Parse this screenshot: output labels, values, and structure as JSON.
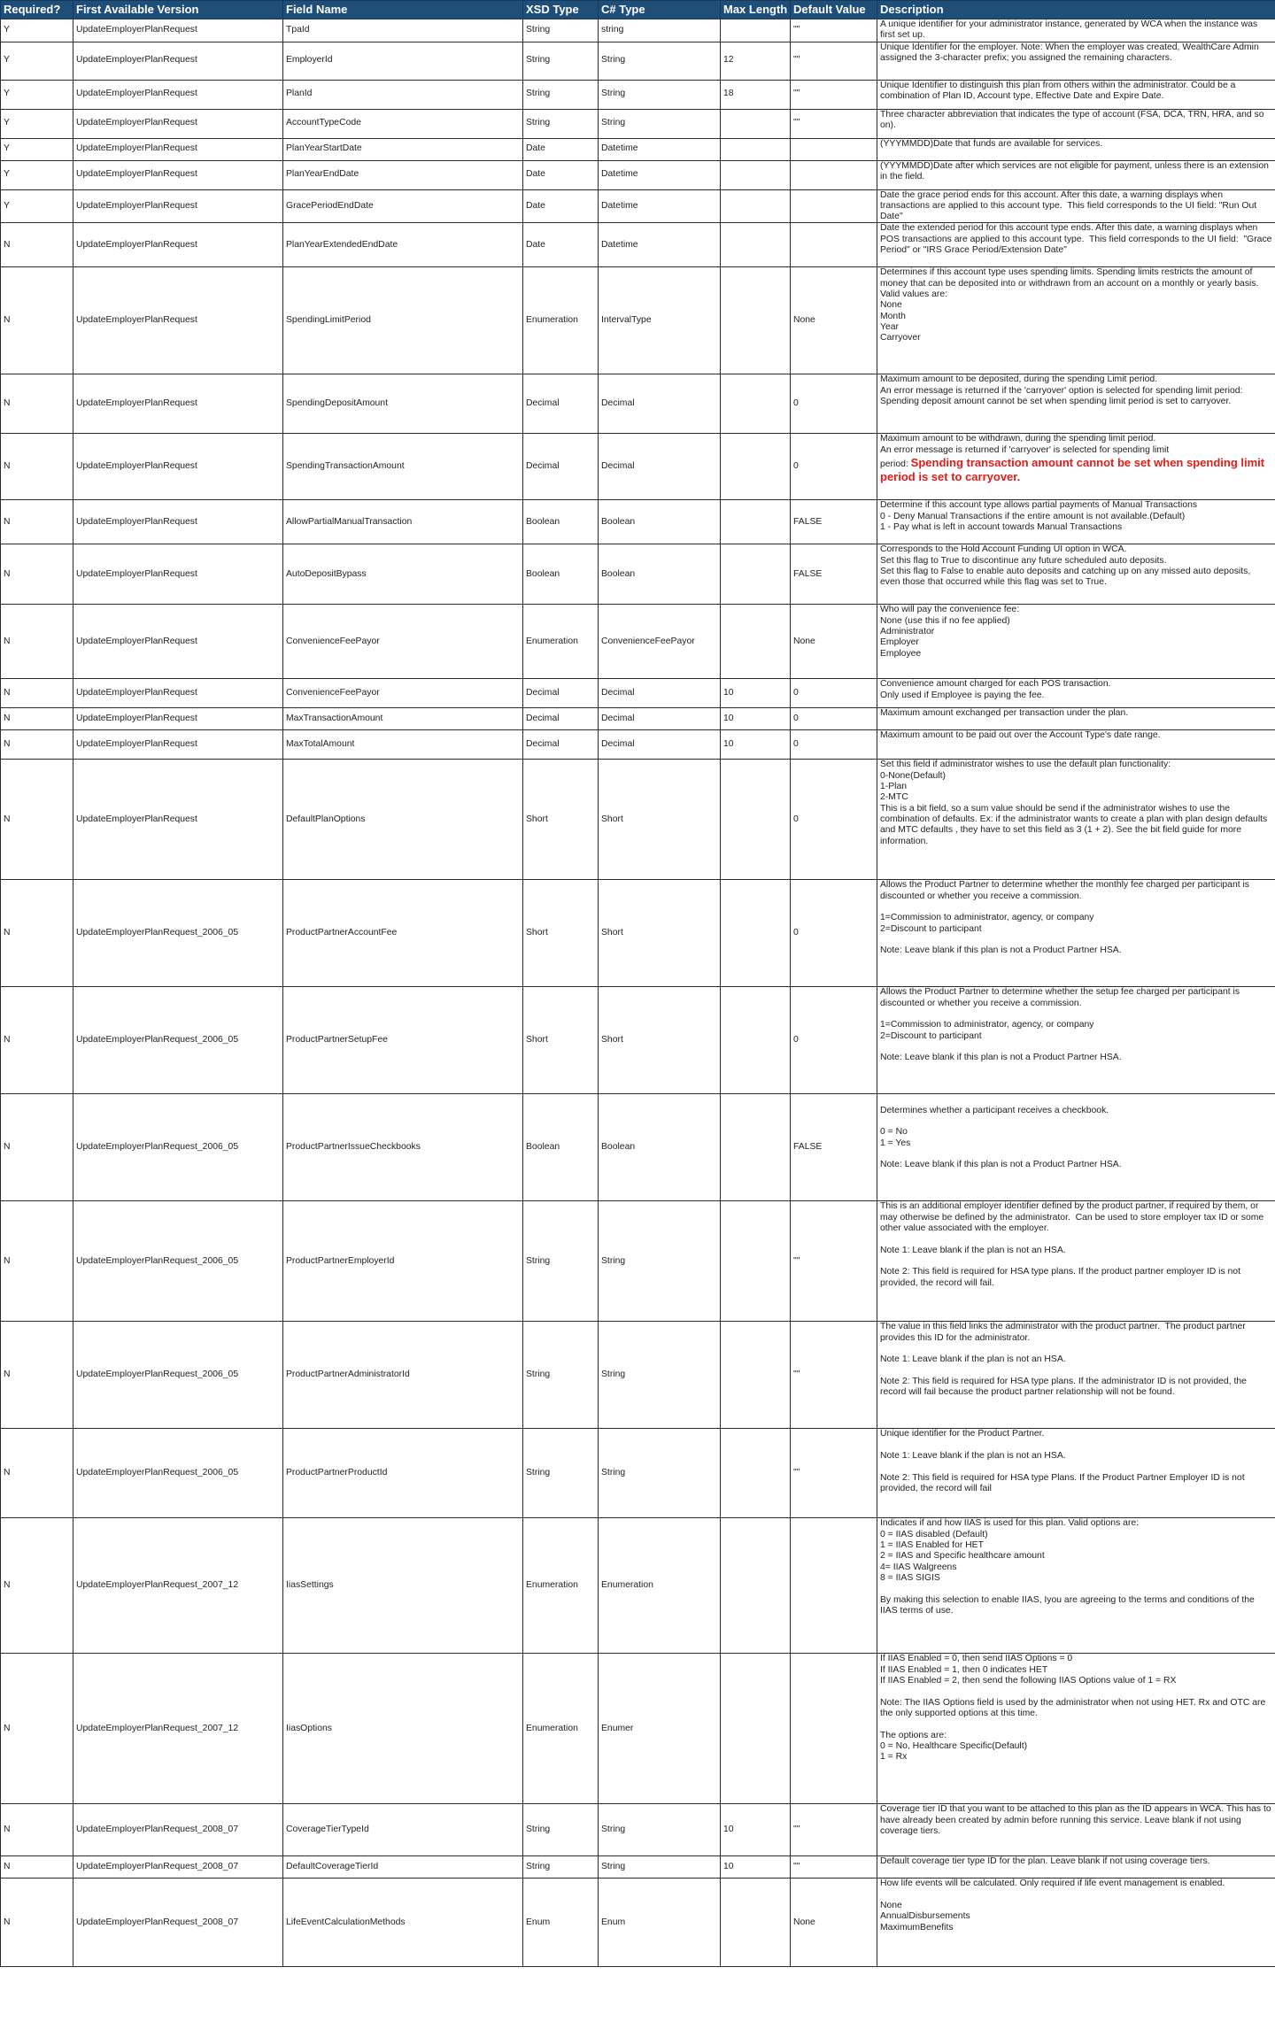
{
  "headers": [
    "Required?",
    "First Available Version",
    "Field Name",
    "XSD Type",
    "C# Type",
    "Max Length",
    "Default Value",
    "Description"
  ],
  "rows": [
    {
      "req": "Y",
      "ver": "UpdateEmployerPlanRequest",
      "field": "TpaId",
      "xsd": "String",
      "cs": "string",
      "max": "",
      "def": "\"\"",
      "desc": "A unique identifier for your administrator instance, generated by WCA when the instance was first set up."
    },
    {
      "req": "Y",
      "ver": "UpdateEmployerPlanRequest",
      "field": "EmployerId",
      "xsd": "String",
      "cs": "String",
      "max": "12",
      "def": "\"\"",
      "desc": "Unique Identifier for the employer. Note: When the employer was created, WealthCare Admin assigned the 3-character prefix; you assigned the remaining characters."
    },
    {
      "req": "Y",
      "ver": "UpdateEmployerPlanRequest",
      "field": "PlanId",
      "xsd": "String",
      "cs": "String",
      "max": "18",
      "def": "\"\"",
      "desc": "Unique Identifier to distinguish this plan from others within the administrator. Could be a combination of Plan ID, Account type, Effective Date and Expire Date."
    },
    {
      "req": "Y",
      "ver": "UpdateEmployerPlanRequest",
      "field": "AccountTypeCode",
      "xsd": "String",
      "cs": "String",
      "max": "",
      "def": "\"\"",
      "desc": "Three character abbreviation that indicates the type of account (FSA, DCA, TRN, HRA, and so on)."
    },
    {
      "req": "Y",
      "ver": "UpdateEmployerPlanRequest",
      "field": "PlanYearStartDate",
      "xsd": "Date",
      "cs": "Datetime",
      "max": "",
      "def": "",
      "desc": "(YYYMMDD)Date that funds are available for services."
    },
    {
      "req": "Y",
      "ver": "UpdateEmployerPlanRequest",
      "field": "PlanYearEndDate",
      "xsd": "Date",
      "cs": "Datetime",
      "max": "",
      "def": "",
      "desc": "(YYYMMDD)Date after which services are not eligible for payment, unless there is an extension in the field."
    },
    {
      "req": "Y",
      "ver": "UpdateEmployerPlanRequest",
      "field": "GracePeriodEndDate",
      "xsd": "Date",
      "cs": "Datetime",
      "max": "",
      "def": "",
      "desc": "Date the grace period ends for this account. After this date, a warning displays when transactions are applied to this account type.  This field corresponds to the UI field: \"Run Out Date\""
    },
    {
      "req": "N",
      "ver": "UpdateEmployerPlanRequest",
      "field": "PlanYearExtendedEndDate",
      "xsd": "Date",
      "cs": "Datetime",
      "max": "",
      "def": "",
      "desc": "Date the extended period for this account type ends. After this date, a warning displays when POS transactions are applied to this account type.  This field corresponds to the UI field:  \"Grace Period\" or \"IRS Grace Period/Extension Date\""
    },
    {
      "req": "N",
      "ver": "UpdateEmployerPlanRequest",
      "field": "SpendingLimitPeriod",
      "xsd": "Enumeration",
      "cs": "IntervalType",
      "max": "",
      "def": "None",
      "desc": "Determines if this account type uses spending limits. Spending limits restricts the amount of money that can be deposited into or withdrawn from an account on a monthly or yearly basis. Valid values are:\nNone\nMonth\nYear\nCarryover"
    },
    {
      "req": "N",
      "ver": "UpdateEmployerPlanRequest",
      "field": "SpendingDepositAmount",
      "xsd": "Decimal",
      "cs": "Decimal",
      "max": "",
      "def": "0",
      "desc": "Maximum amount to be deposited, during the spending Limit period.\nAn error message is returned if the 'carryover' option is selected for spending limit period: Spending deposit amount cannot be set when spending limit period is set to carryover."
    },
    {
      "req": "N",
      "ver": "UpdateEmployerPlanRequest",
      "field": "SpendingTransactionAmount",
      "xsd": "Decimal",
      "cs": "Decimal",
      "max": "",
      "def": "0",
      "desc": "Maximum amount to be withdrawn, during the spending limit period.\nAn error message is returned if 'carryover' is selected for spending limit\nperiod: ",
      "desc_warn": "Spending transaction amount cannot be set when spending limit period is set to carryover."
    },
    {
      "req": "N",
      "ver": "UpdateEmployerPlanRequest",
      "field": "AllowPartialManualTransaction",
      "xsd": "Boolean",
      "cs": "Boolean",
      "max": "",
      "def": "FALSE",
      "desc": "Determine if this account type allows partial payments of Manual Transactions\n0 - Deny Manual Transactions if the entire amount is not available.(Default)\n1 - Pay what is left in account towards Manual Transactions"
    },
    {
      "req": "N",
      "ver": "UpdateEmployerPlanRequest",
      "field": "AutoDepositBypass",
      "xsd": "Boolean",
      "cs": "Boolean",
      "max": "",
      "def": "FALSE",
      "desc": "Corresponds to the Hold Account Funding UI option in WCA.\nSet this flag to True to discontinue any future scheduled auto deposits.\nSet this flag to False to enable auto deposits and catching up on any missed auto deposits, even those that occurred while this flag was set to True."
    },
    {
      "req": "N",
      "ver": "UpdateEmployerPlanRequest",
      "field": "ConvenienceFeePayor",
      "xsd": "Enumeration",
      "cs": "ConvenienceFeePayor",
      "max": "",
      "def": "None",
      "desc": "Who will pay the convenience fee:\nNone (use this if no fee applied)\nAdministrator\nEmployer\nEmployee"
    },
    {
      "req": "N",
      "ver": "UpdateEmployerPlanRequest",
      "field": "ConvenienceFeePayor",
      "xsd": "Decimal",
      "cs": "Decimal",
      "max": "10",
      "def": "0",
      "desc": "Convenience amount charged for each POS transaction.\nOnly used if Employee is paying the fee."
    },
    {
      "req": "N",
      "ver": "UpdateEmployerPlanRequest",
      "field": "MaxTransactionAmount",
      "xsd": "Decimal",
      "cs": "Decimal",
      "max": "10",
      "def": "0",
      "desc": "Maximum amount exchanged per transaction under the plan."
    },
    {
      "req": "N",
      "ver": "UpdateEmployerPlanRequest",
      "field": "MaxTotalAmount",
      "xsd": "Decimal",
      "cs": "Decimal",
      "max": "10",
      "def": "0",
      "desc": "Maximum amount to be paid out over the Account Type's date range."
    },
    {
      "req": "N",
      "ver": "UpdateEmployerPlanRequest",
      "field": "DefaultPlanOptions",
      "xsd": "Short",
      "cs": "Short",
      "max": "",
      "def": "0",
      "desc": "Set this field if administrator wishes to use the default plan functionality:\n0-None(Default)\n1-Plan\n2-MTC\nThis is a bit field, so a sum value should be send if the administrator wishes to use the combination of defaults. Ex: if the administrator wants to create a plan with plan design defaults and MTC defaults , they have to set this field as 3 (1 + 2). See the bit field guide for more information."
    },
    {
      "req": "N",
      "ver": "UpdateEmployerPlanRequest_2006_05",
      "field": "ProductPartnerAccountFee",
      "xsd": "Short",
      "cs": "Short",
      "max": "",
      "def": "0",
      "desc": "Allows the Product Partner to determine whether the monthly fee charged per participant is discounted or whether you receive a commission.\n\n1=Commission to administrator, agency, or company\n2=Discount to participant\n\nNote: Leave blank if this plan is not a Product Partner HSA."
    },
    {
      "req": "N",
      "ver": "UpdateEmployerPlanRequest_2006_05",
      "field": "ProductPartnerSetupFee",
      "xsd": "Short",
      "cs": "Short",
      "max": "",
      "def": "0",
      "desc": "Allows the Product Partner to determine whether the setup fee charged per participant is discounted or whether you receive a commission.\n\n1=Commission to administrator, agency, or company\n2=Discount to participant\n\nNote: Leave blank if this plan is not a Product Partner HSA."
    },
    {
      "req": "N",
      "ver": "UpdateEmployerPlanRequest_2006_05",
      "field": "ProductPartnerIssueCheckbooks",
      "xsd": "Boolean",
      "cs": "Boolean",
      "max": "",
      "def": "FALSE",
      "desc": "\nDetermines whether a participant receives a checkbook.\n\n0 = No\n1 = Yes\n\nNote: Leave blank if this plan is not a Product Partner HSA."
    },
    {
      "req": "N",
      "ver": "UpdateEmployerPlanRequest_2006_05",
      "field": "ProductPartnerEmployerId",
      "xsd": "String",
      "cs": "String",
      "max": "",
      "def": "\"\"",
      "desc": "This is an additional employer identifier defined by the product partner, if required by them, or may otherwise be defined by the administrator.  Can be used to store employer tax ID or some other value associated with the employer.\n\nNote 1: Leave blank if the plan is not an HSA.\n\nNote 2: This field is required for HSA type plans. If the product partner employer ID is not provided, the record will fail."
    },
    {
      "req": "N",
      "ver": "UpdateEmployerPlanRequest_2006_05",
      "field": "ProductPartnerAdministratorId",
      "xsd": "String",
      "cs": "String",
      "max": "",
      "def": "\"\"",
      "desc": "The value in this field links the administrator with the product partner.  The product partner provides this ID for the administrator.\n\nNote 1: Leave blank if the plan is not an HSA.\n\nNote 2: This field is required for HSA type plans. If the administrator ID is not provided, the record will fail because the product partner relationship will not be found."
    },
    {
      "req": "N",
      "ver": "UpdateEmployerPlanRequest_2006_05",
      "field": "ProductPartnerProductId",
      "xsd": "String",
      "cs": "String",
      "max": "",
      "def": "\"\"",
      "desc": "Unique identifier for the Product Partner.\n\nNote 1: Leave blank if the plan is not an HSA.\n\nNote 2: This field is required for HSA type Plans. If the Product Partner Employer ID is not provided, the record will fail"
    },
    {
      "req": "N",
      "ver": "UpdateEmployerPlanRequest_2007_12",
      "field": "IiasSettings",
      "xsd": "Enumeration",
      "cs": "Enumeration",
      "max": "",
      "def": "",
      "desc": "Indicates if and how IIAS is used for this plan. Valid options are:\n0 = IIAS disabled (Default)\n1 = IIAS Enabled for HET\n2 = IIAS and Specific healthcare amount\n4= IIAS Walgreens\n8 = IIAS SIGIS\n\nBy making this selection to enable IIAS, Iyou are agreeing to the terms and conditions of the IIAS terms of use."
    },
    {
      "req": "N",
      "ver": "UpdateEmployerPlanRequest_2007_12",
      "field": "IiasOptions",
      "xsd": "Enumeration",
      "cs": "Enumer",
      "max": "",
      "def": "",
      "desc": "If IIAS Enabled = 0, then send IIAS Options = 0\nIf IIAS Enabled = 1, then 0 indicates HET\nIf IIAS Enabled = 2, then send the following IIAS Options value of 1 = RX\n\nNote: The IIAS Options field is used by the administrator when not using HET. Rx and OTC are the only supported options at this time.\n\nThe options are:\n0 = No, Healthcare Specific(Default)\n1 = Rx"
    },
    {
      "req": "N",
      "ver": "UpdateEmployerPlanRequest_2008_07",
      "field": "CoverageTierTypeId",
      "xsd": "String",
      "cs": "String",
      "max": "10",
      "def": "\"\"",
      "desc": "Coverage tier ID that you want to be attached to this plan as the ID appears in WCA. This has to have already been created by admin before running this service. Leave blank if not using coverage tiers."
    },
    {
      "req": "N",
      "ver": "UpdateEmployerPlanRequest_2008_07",
      "field": "DefaultCoverageTierId",
      "xsd": "String",
      "cs": "String",
      "max": "10",
      "def": "\"\"",
      "desc": "Default coverage tier type ID for the plan. Leave blank if not using coverage tiers."
    },
    {
      "req": "N",
      "ver": "UpdateEmployerPlanRequest_2008_07",
      "field": "LifeEventCalculationMethods",
      "xsd": "Enum",
      "cs": "Enum",
      "max": "",
      "def": "None",
      "desc": "How life events will be calculated. Only required if life event management is enabled.\n\nNone\nAnnualDisbursements\nMaximumBenefits"
    }
  ]
}
